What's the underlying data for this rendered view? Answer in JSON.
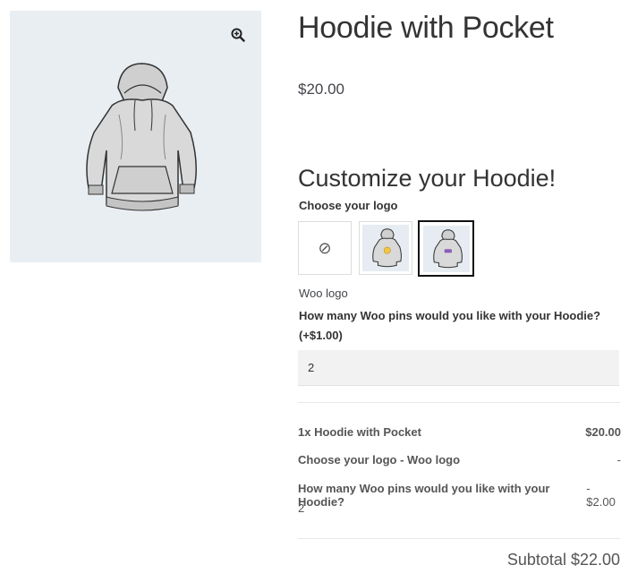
{
  "product": {
    "title": "Hoodie with Pocket",
    "price": "$20.00",
    "image_alt": "grey-hoodie-image"
  },
  "customizer": {
    "heading": "Customize your Hoodie!",
    "logo_label": "Choose your logo",
    "swatches": [
      {
        "name": "none",
        "icon": "no-entry-icon"
      },
      {
        "name": "yellow-logo",
        "icon": "hoodie-yellow-logo-icon"
      },
      {
        "name": "woo-logo",
        "icon": "hoodie-woo-logo-icon",
        "selected": true
      }
    ],
    "selected_logo_name": "Woo logo",
    "pins_label": "How many Woo pins would you like with your Hoodie? (+$1.00)",
    "pins_value": "2"
  },
  "summary": {
    "rows": [
      {
        "label": "1x Hoodie with Pocket",
        "value": "$20.00"
      },
      {
        "label": "Choose your logo - Woo logo",
        "value": "-"
      },
      {
        "label": "How many Woo pins would you like with your Hoodie?",
        "value": "- $2.00",
        "sub": "2"
      }
    ],
    "subtotal": "Subtotal $22.00"
  },
  "colors": {
    "gallery_bg": "#e9eef3",
    "input_bg": "#f2f2f2",
    "selected_border": "#111111"
  }
}
